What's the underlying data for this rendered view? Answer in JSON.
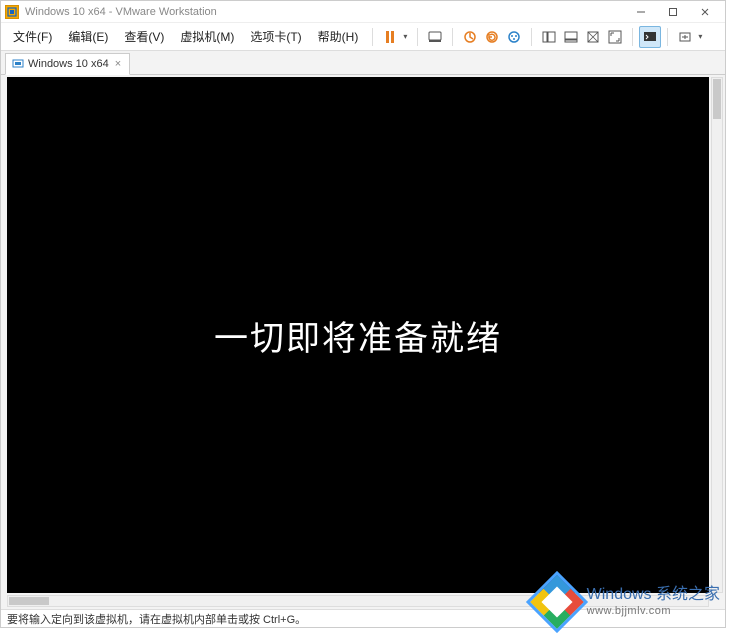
{
  "title": "Windows 10 x64 - VMware Workstation",
  "menu": {
    "file": "文件(F)",
    "edit": "编辑(E)",
    "view": "查看(V)",
    "vm": "虚拟机(M)",
    "tabs": "选项卡(T)",
    "help": "帮助(H)"
  },
  "tab": {
    "label": "Windows 10 x64"
  },
  "vm": {
    "message": "一切即将准备就绪"
  },
  "status": {
    "text": "要将输入定向到该虚拟机，请在虚拟机内部单击或按 Ctrl+G。"
  },
  "watermark": {
    "brand": "Windows 系统之家",
    "url": "www.bjjmlv.com"
  },
  "icons": {
    "app": "vmware-icon",
    "minimize": "minimize-icon",
    "maximize": "maximize-icon",
    "close": "close-icon",
    "pause": "pause-icon",
    "snapshot": "snapshot-icon",
    "revert": "revert-icon",
    "take": "take-icon",
    "manage": "manage-icon",
    "single": "single-view-icon",
    "multi": "multi-view-icon",
    "unity": "unity-icon",
    "fullscreen": "fullscreen-icon",
    "console": "console-icon",
    "stretch": "stretch-icon"
  },
  "colors": {
    "pause": "#e67e22",
    "snapshot1": "#e67e22",
    "snapshot2": "#e67e22",
    "snapshot3": "#2c82c9"
  }
}
